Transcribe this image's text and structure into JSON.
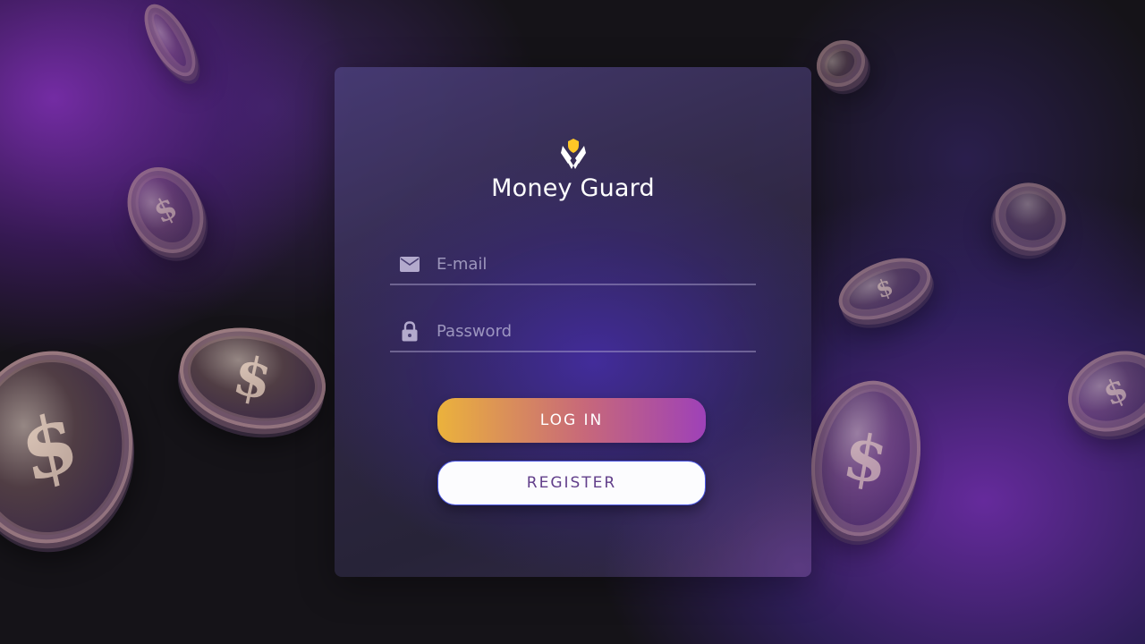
{
  "app": {
    "name": "Money Guard"
  },
  "login_form": {
    "email_placeholder": "E-mail",
    "email_value": "",
    "password_placeholder": "Password",
    "password_value": "",
    "login_label": "LOG IN",
    "register_label": "REGISTER"
  },
  "icons": {
    "logo": "money-guard-logo-icon",
    "email": "envelope-icon",
    "password": "lock-icon"
  },
  "colors": {
    "accent_yellow": "#ebb23c",
    "accent_purple": "#9e41b8",
    "register_text": "#623f8b",
    "logo_shield": "#ffc727"
  },
  "background": {
    "decoration": "falling-dollar-coins"
  }
}
